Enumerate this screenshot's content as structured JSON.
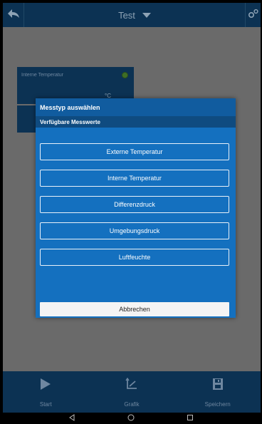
{
  "header": {
    "title": "Test"
  },
  "tile": {
    "label": "Interne Temperatur",
    "unit": "°C"
  },
  "dialog": {
    "title": "Messtyp auswählen",
    "subtitle": "Verfügbare Messwerte",
    "options": [
      {
        "label": "Externe Temperatur"
      },
      {
        "label": "Interne Temperatur"
      },
      {
        "label": "Differenzdruck"
      },
      {
        "label": "Umgebungsdruck"
      },
      {
        "label": "Luftfeuchte"
      }
    ],
    "cancel_label": "Abbrechen"
  },
  "bottom_bar": {
    "items": [
      {
        "label": "Start",
        "icon": "play-icon"
      },
      {
        "label": "Grafik",
        "icon": "graph-icon"
      },
      {
        "label": "Speichern",
        "icon": "save-icon"
      }
    ]
  },
  "colors": {
    "dialog_bg": "#1470bf",
    "bar_bg": "#0c3253",
    "status_ok": "#3e6e26"
  }
}
